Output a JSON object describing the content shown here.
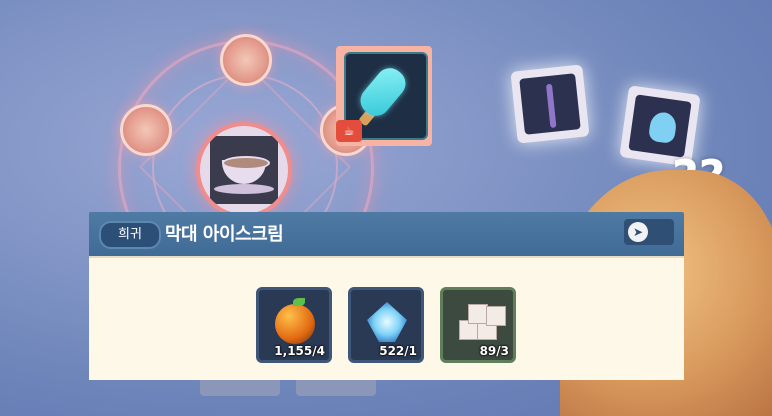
{
  "item": {
    "rarity": "희귀",
    "name": "막대 아이스크림"
  },
  "ingredients": [
    {
      "icon": "golden-apple-icon",
      "count": "1,155/4"
    },
    {
      "icon": "ice-crystal-icon",
      "count": "522/1"
    },
    {
      "icon": "sugar-cubes-icon",
      "count": "89/3"
    }
  ],
  "decor": {
    "question_marks": "??"
  },
  "colors": {
    "header": "#4f7aa4",
    "body": "#fdf8e8",
    "selected_frame": "#f7b4a4"
  }
}
